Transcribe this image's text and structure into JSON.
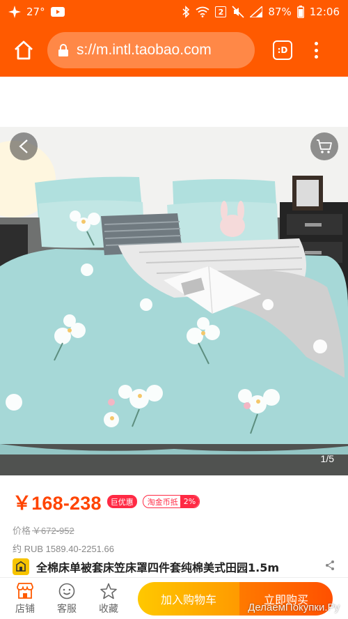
{
  "status_bar": {
    "temperature": "27°",
    "battery": "87%",
    "time": "12:06",
    "notification_count": "2"
  },
  "browser": {
    "url": "s://m.intl.taobao.com",
    "tabs_label": ":D"
  },
  "product": {
    "image_counter": "1/5",
    "price": "￥168-238",
    "tag_promo": "巨优惠",
    "tag_coin_label": "淘金币抵",
    "tag_coin_value": "2%",
    "original_price_label": "价格",
    "original_price": "￥672-952",
    "approx_price": "约 RUB 1589.40-2251.66",
    "title": "全棉床单被套床笠床罩四件套纯棉美式田园1.5m"
  },
  "bottom_bar": {
    "shop_label": "店铺",
    "service_label": "客服",
    "favorite_label": "收藏",
    "add_to_cart_label": "加入购物车",
    "buy_now_label": "立即购买"
  },
  "watermark": "ДелаемПокупки.Ру",
  "colors": {
    "brand": "#ff5a00",
    "price": "#ff4400",
    "tag": "#ff2a44"
  }
}
